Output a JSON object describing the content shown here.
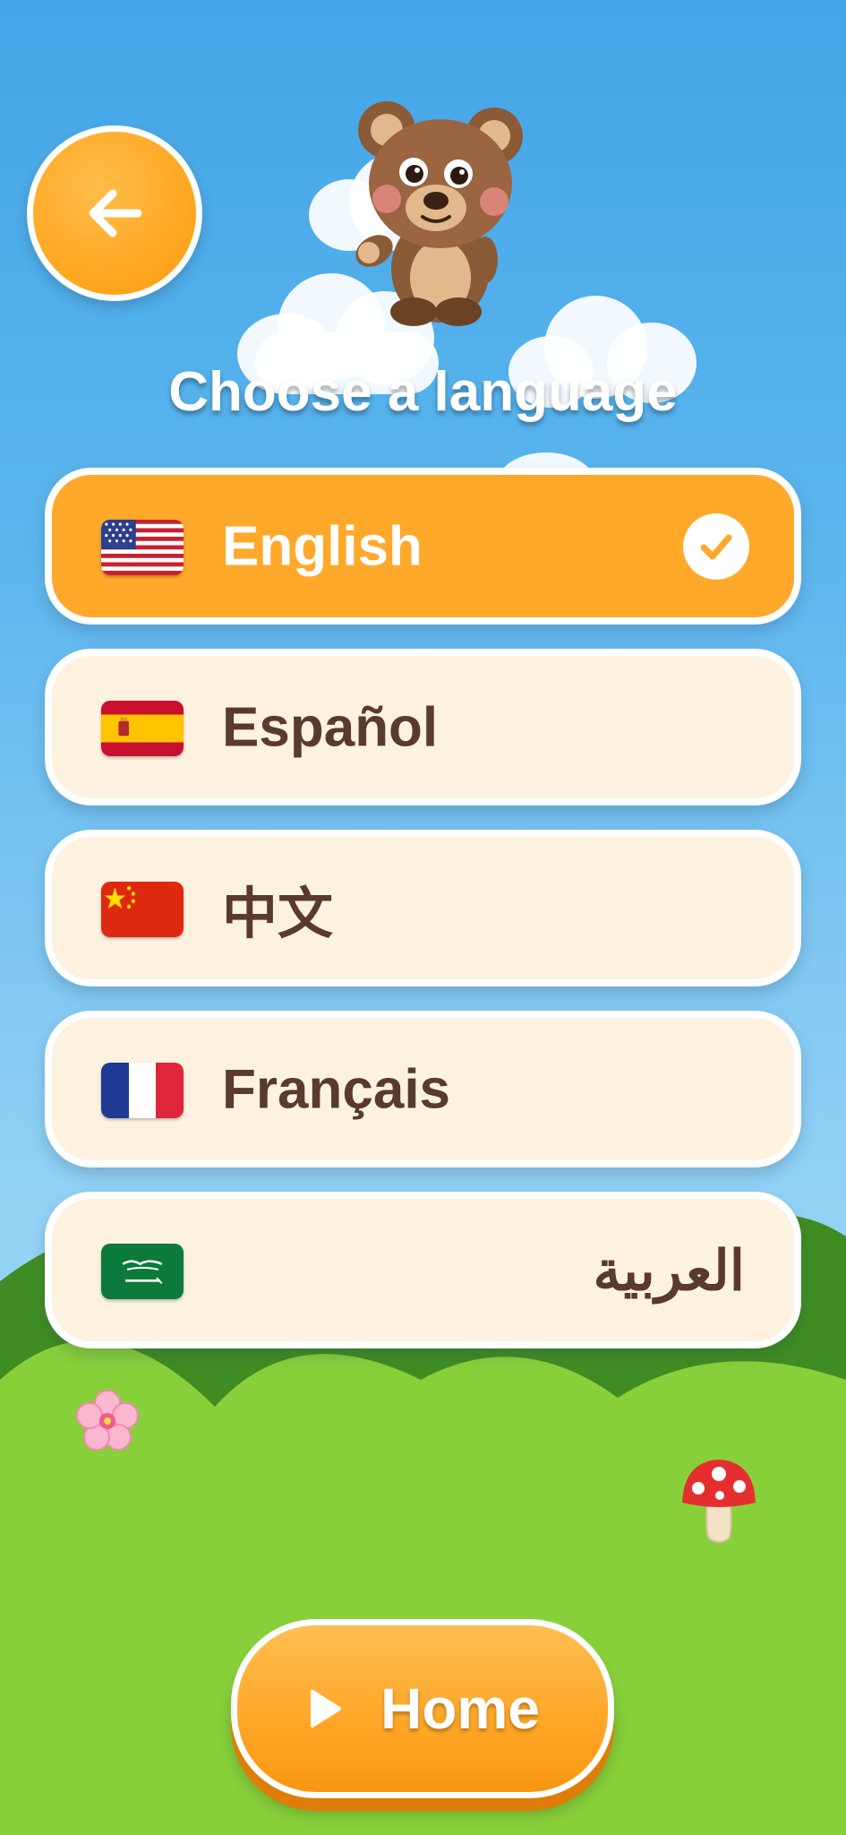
{
  "header": {
    "back_button_icon": "arrow-left-icon",
    "mascot": "bear-mascot"
  },
  "title": "Choose a language",
  "languages": [
    {
      "label": "English",
      "flag": "us-flag-icon",
      "selected": true
    },
    {
      "label": "Español",
      "flag": "spain-flag-icon",
      "selected": false
    },
    {
      "label": "中文",
      "flag": "china-flag-icon",
      "selected": false
    },
    {
      "label": "Français",
      "flag": "france-flag-icon",
      "selected": false
    },
    {
      "label": "العربية",
      "flag": "saudi-flag-icon",
      "selected": false
    }
  ],
  "home_button": {
    "label": "Home",
    "icon": "play-icon"
  },
  "decorations": [
    "cherry-blossom-icon",
    "mushroom-icon"
  ],
  "colors": {
    "accent": "#ffa82a",
    "card_bg": "#fdf2df",
    "text_dark": "#5a3a2c",
    "grass": "#86d038",
    "sky": "#43a5e6"
  }
}
